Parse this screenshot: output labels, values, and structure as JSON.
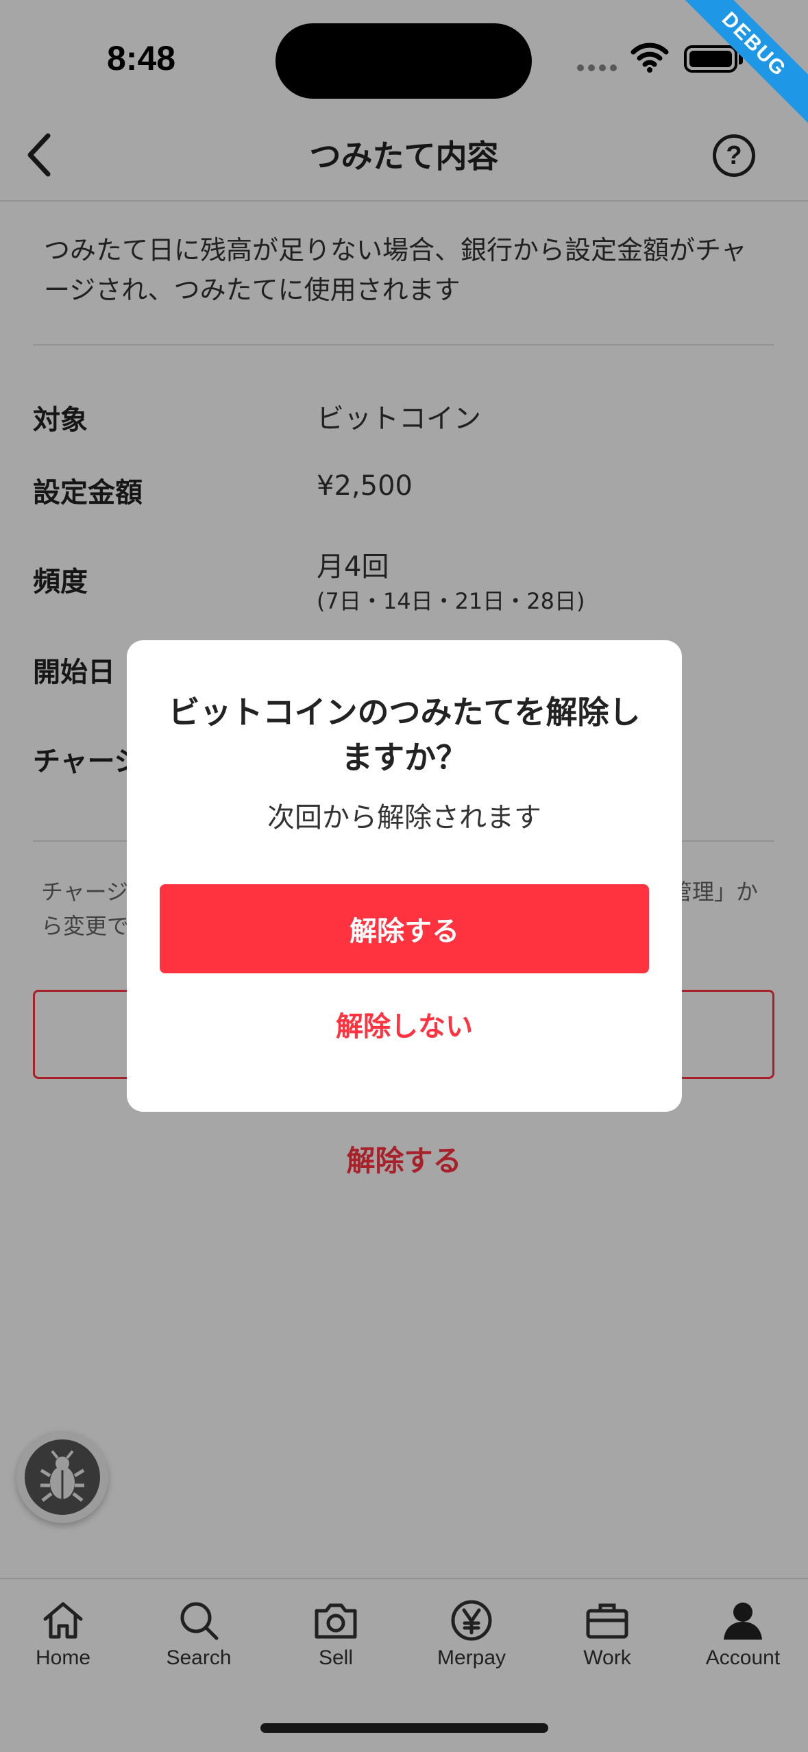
{
  "status_bar": {
    "time": "8:48"
  },
  "debug_badge": "DEBUG",
  "header": {
    "title": "つみたて内容",
    "help_label": "?"
  },
  "description": "つみたて日に残高が足りない場合、銀行から設定金額がチャージされ、つみたてに使用されます",
  "details": {
    "target_label": "対象",
    "target_value": "ビットコイン",
    "amount_label": "設定金額",
    "amount_value": "¥2,500",
    "frequency_label": "頻度",
    "frequency_value": "月4回",
    "frequency_sub": "(7日・14日・21日・28日)",
    "start_label": "開始日",
    "charge_label": "チャージ"
  },
  "note": {
    "start": "チャージ",
    "end": "管理」か",
    "line2_start": "ら変更で"
  },
  "cancel_link": "解除する",
  "dialog": {
    "title": "ビットコインのつみたてを解除しますか？",
    "message": "次回から解除されます",
    "confirm_label": "解除する",
    "dismiss_label": "解除しない"
  },
  "tabbar": {
    "items": [
      {
        "label": "Home",
        "icon": "home-icon"
      },
      {
        "label": "Search",
        "icon": "search-icon"
      },
      {
        "label": "Sell",
        "icon": "camera-icon"
      },
      {
        "label": "Merpay",
        "icon": "yen-icon"
      },
      {
        "label": "Work",
        "icon": "briefcase-icon"
      },
      {
        "label": "Account",
        "icon": "person-icon"
      }
    ]
  },
  "colors": {
    "accent": "#ff333f",
    "overlay": "rgba(0,0,0,0.35)",
    "debug": "#1d97e6"
  }
}
